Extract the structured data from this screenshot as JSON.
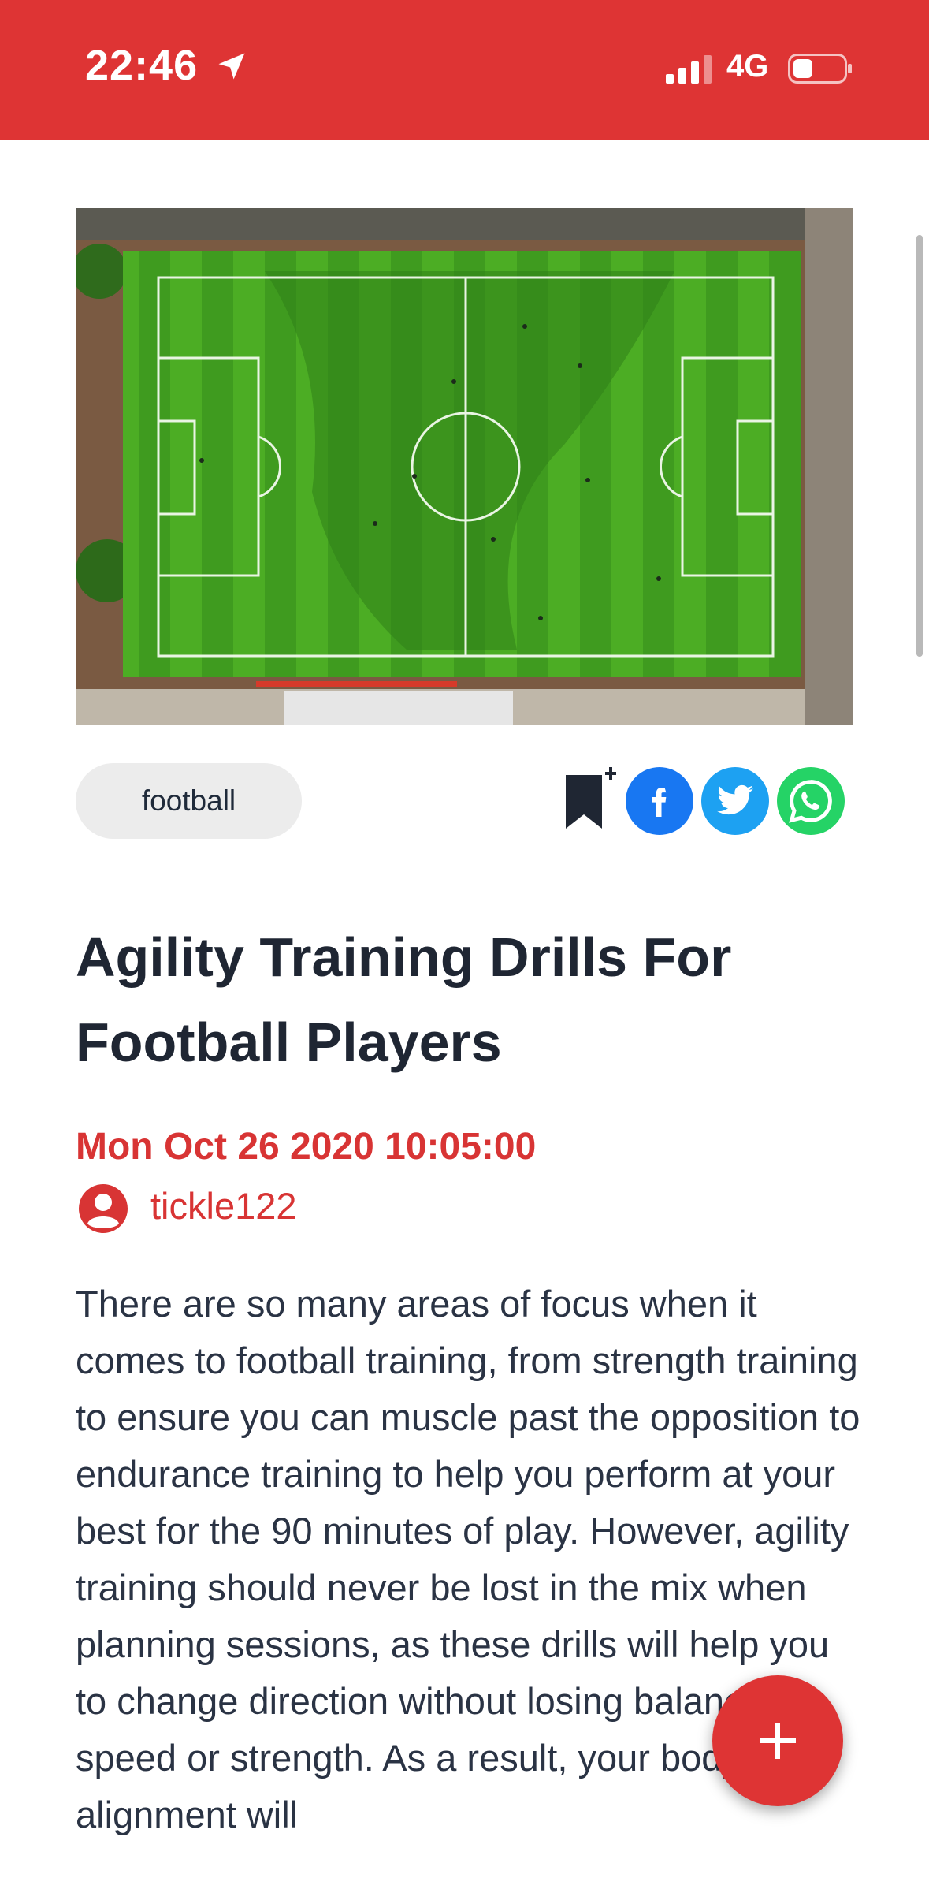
{
  "status_bar": {
    "time": "22:46",
    "network": "4G",
    "icons": [
      "location-arrow-icon",
      "signal-bars-icon",
      "battery-icon"
    ]
  },
  "article": {
    "hero_image_alt": "football pitch aerial view",
    "tag": "football",
    "title": "Agility Training Drills For Football Players",
    "date": "Mon Oct 26 2020 10:05:00",
    "author": "tickle122",
    "body": "There are so many areas of focus when it comes to football training, from strength training to ensure you can muscle past the opposition to endurance training to help you perform at your best for the 90 minutes of play. However, agility training should never be lost in the mix when planning sessions, as these drills will help you to change direction without losing balance, speed or strength. As a result, your body’s alignment will"
  },
  "share": {
    "icons": [
      "bookmark-add-icon",
      "facebook-icon",
      "twitter-icon",
      "whatsapp-icon"
    ]
  },
  "fab": {
    "label": "+"
  },
  "colors": {
    "brand_red": "#de3434",
    "text_dark": "#1f2633",
    "tag_bg": "#ececec",
    "facebook": "#1877f2",
    "twitter": "#1da1f2",
    "whatsapp": "#25d366"
  }
}
